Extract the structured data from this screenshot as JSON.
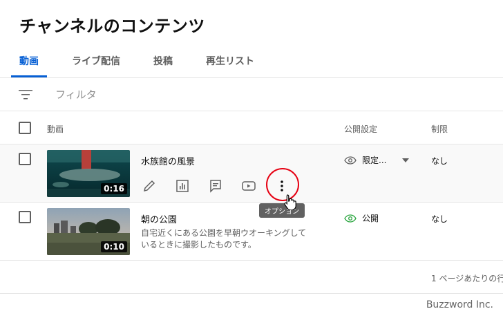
{
  "page": {
    "title": "チャンネルのコンテンツ"
  },
  "tabs": [
    {
      "label": "動画",
      "active": true
    },
    {
      "label": "ライブ配信"
    },
    {
      "label": "投稿"
    },
    {
      "label": "再生リスト"
    }
  ],
  "filter": {
    "placeholder": "フィルタ",
    "icon": "filter-icon"
  },
  "table": {
    "headers": {
      "video": "動画",
      "visibility": "公開設定",
      "restrictions": "制限"
    },
    "rows": [
      {
        "title": "水族館の風景",
        "description": "",
        "duration": "0:16",
        "visibility": "限定...",
        "visibility_icon": "eye-icon",
        "restrictions": "なし",
        "actions": [
          "edit-icon",
          "analytics-icon",
          "comments-icon",
          "youtube-icon",
          "options-icon"
        ]
      },
      {
        "title": "朝の公園",
        "description": "自宅近くにある公園を早朝ウオーキングしているときに撮影したものです。",
        "duration": "0:10",
        "visibility": "公開",
        "visibility_icon": "eye-icon",
        "restrictions": "なし"
      }
    ]
  },
  "tooltip": {
    "text": "オプション"
  },
  "pagination": {
    "rows_per_page_label": "1 ページあたりの行"
  },
  "footer": {
    "brand": "Buzzword Inc."
  },
  "colors": {
    "accent": "#065fd4",
    "highlight": "#e60012",
    "public_green": "#2ba640"
  }
}
